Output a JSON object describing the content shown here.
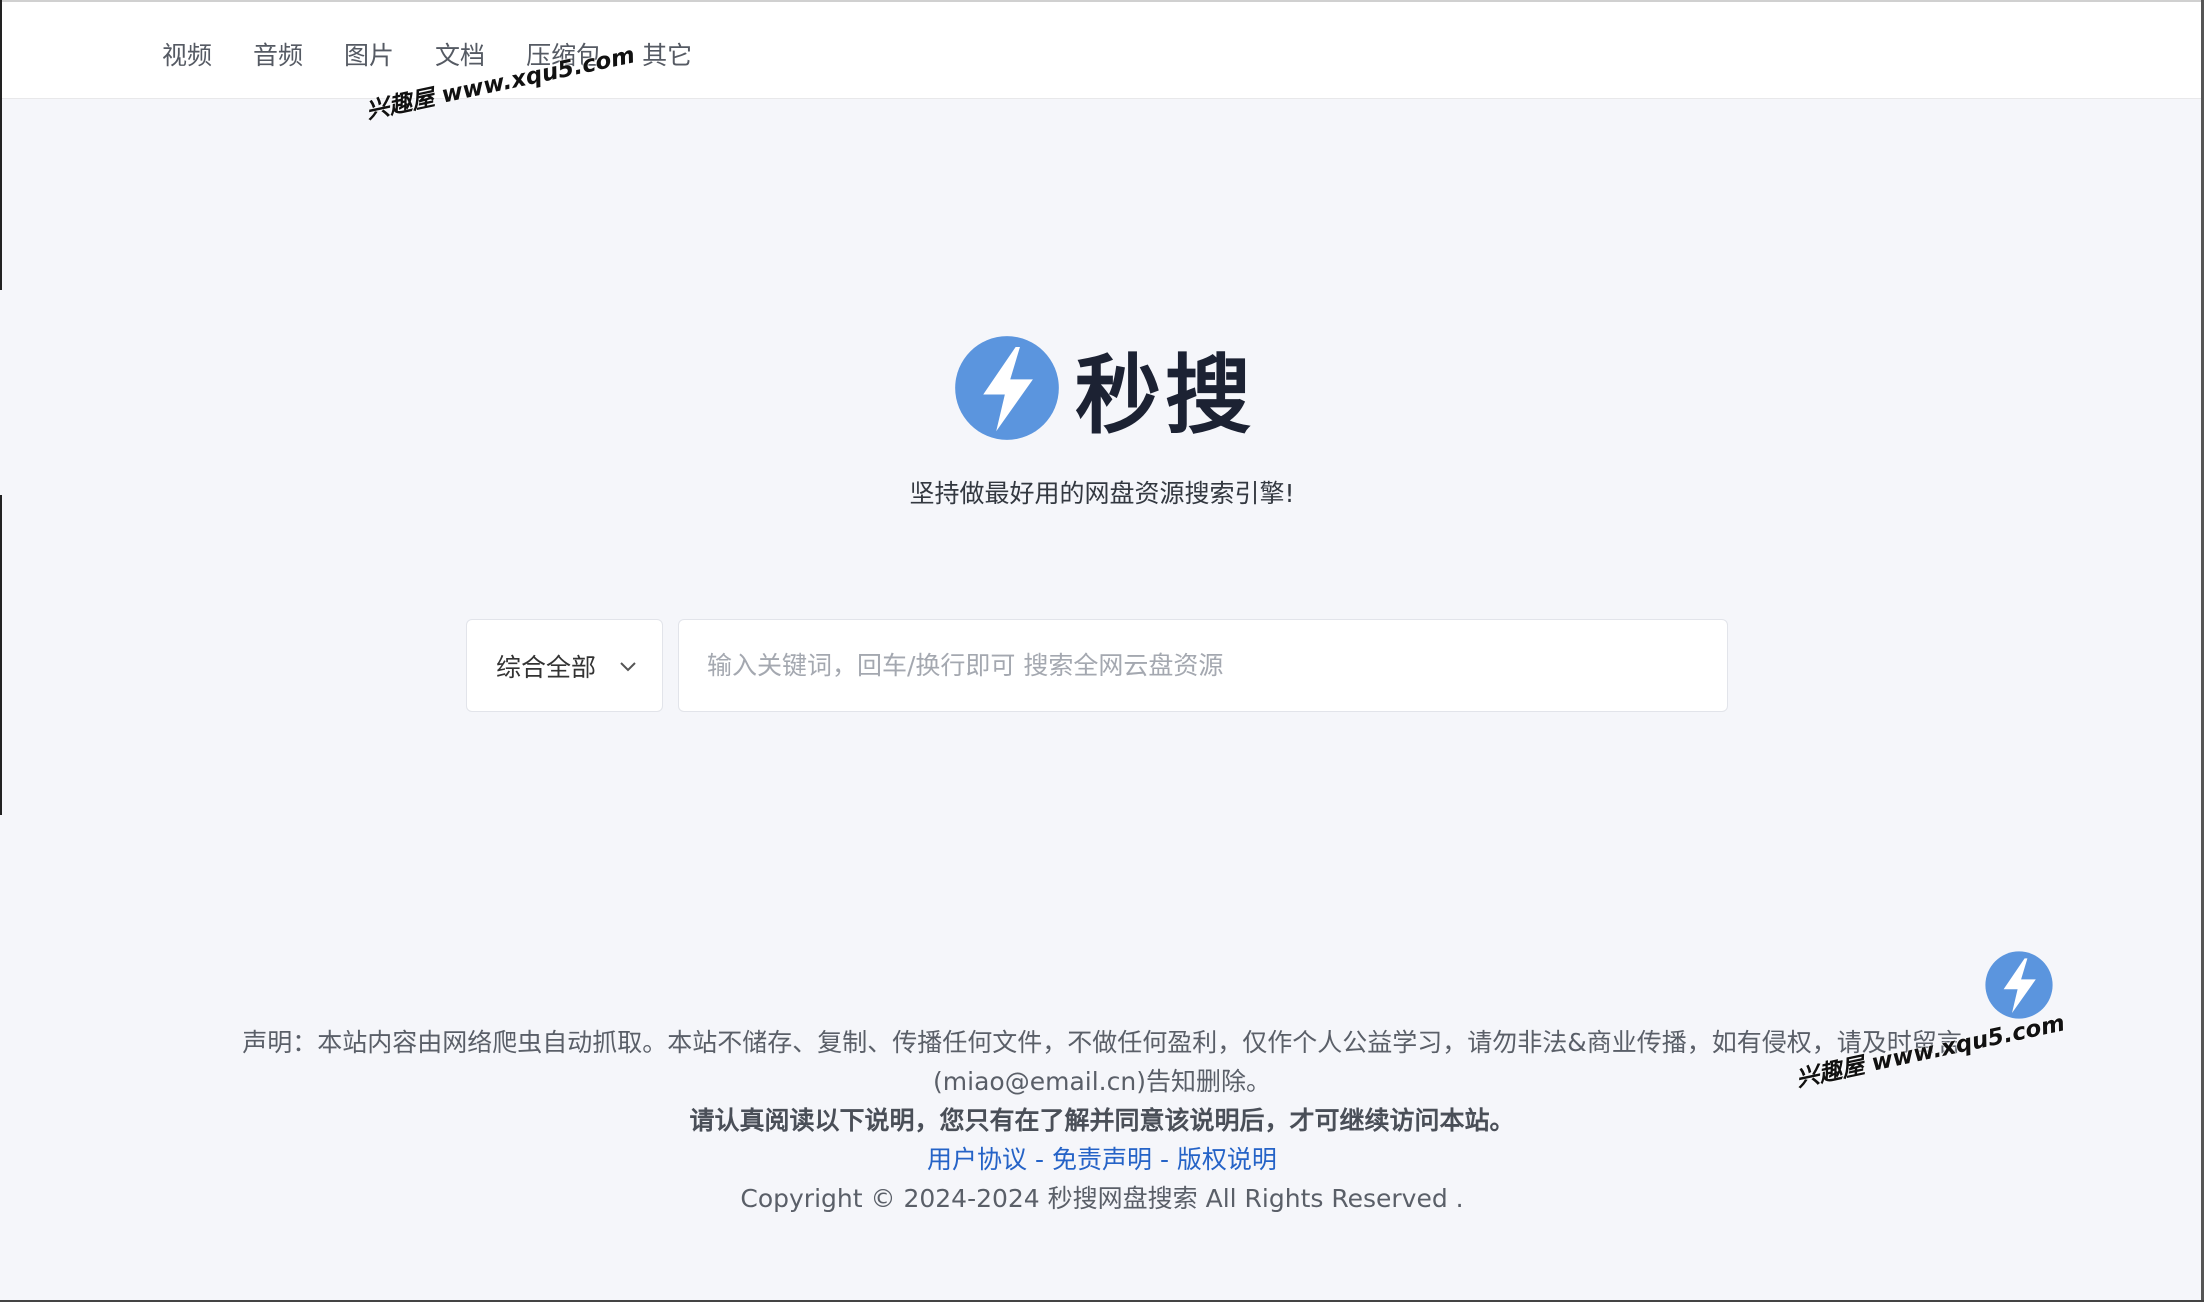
{
  "nav": {
    "items": [
      {
        "label": "视频"
      },
      {
        "label": "音频"
      },
      {
        "label": "图片"
      },
      {
        "label": "文档"
      },
      {
        "label": "压缩包"
      },
      {
        "label": "其它"
      }
    ]
  },
  "watermark": {
    "text": "兴趣屋 www.xqu5.com"
  },
  "brand": {
    "name": "秒搜",
    "icon": "lightning-bolt-icon",
    "color": "#5b95de"
  },
  "slogan": "坚持做最好用的网盘资源搜索引擎!",
  "search": {
    "category_selected": "综合全部",
    "placeholder": "输入关键词，回车/换行即可 搜索全网云盘资源",
    "value": ""
  },
  "footer": {
    "notice": "声明：本站内容由网络爬虫自动抓取。本站不储存、复制、传播任何文件，不做任何盈利，仅作个人公益学习，请勿非法&商业传播，如有侵权，请及时留言(miao@email.cn)告知删除。",
    "warning": "请认真阅读以下说明，您只有在了解并同意该说明后，才可继续访问本站。",
    "links": [
      {
        "label": "用户协议"
      },
      {
        "label": "免责声明"
      },
      {
        "label": "版权说明"
      }
    ],
    "link_separator": " - ",
    "copyright": "Copyright © 2024-2024 秒搜网盘搜索 All Rights Reserved ."
  }
}
